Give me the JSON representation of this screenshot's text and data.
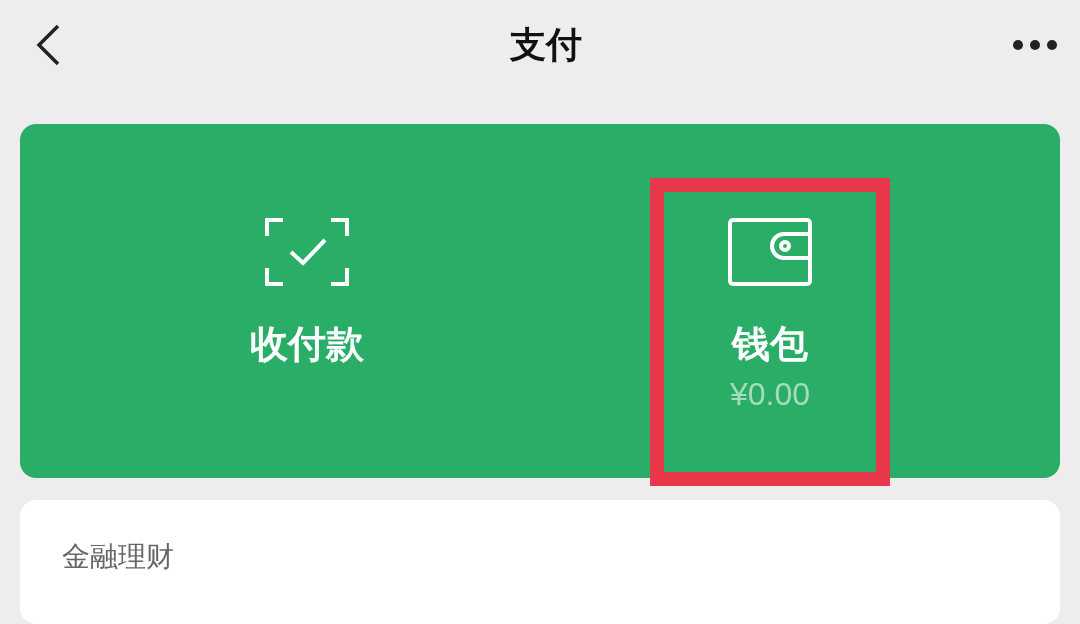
{
  "header": {
    "title": "支付"
  },
  "actions": [
    {
      "kind": "scan",
      "label": "收付款",
      "highlighted": false
    },
    {
      "kind": "wallet",
      "label": "钱包",
      "amount": "¥0.00",
      "highlighted": true
    }
  ],
  "section": {
    "title": "金融理财"
  }
}
